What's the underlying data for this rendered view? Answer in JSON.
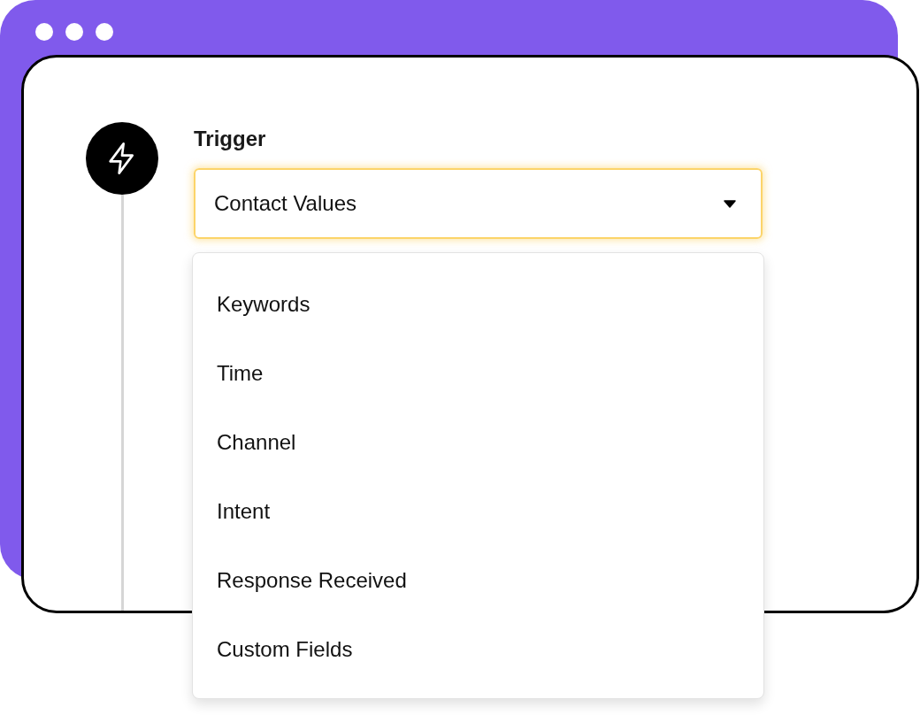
{
  "trigger": {
    "label": "Trigger",
    "value": "Contact Values",
    "expanded": true,
    "options": [
      {
        "label": "Keywords",
        "selected": false
      },
      {
        "label": "Time",
        "selected": false
      },
      {
        "label": "Channel",
        "selected": false
      },
      {
        "label": "Intent",
        "selected": false
      },
      {
        "label": "Response Received",
        "selected": false
      },
      {
        "label": "Custom Fields",
        "selected": false
      }
    ]
  }
}
